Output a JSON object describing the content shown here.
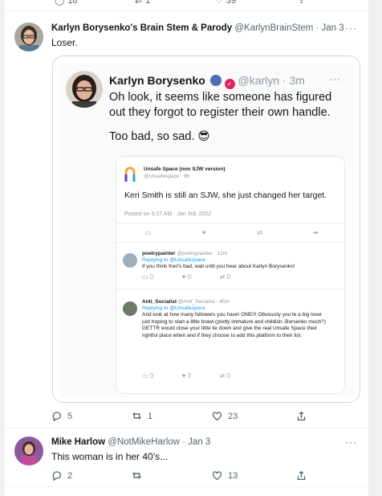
{
  "prev_actions": {
    "reply_count": "18",
    "retweet_count": "1",
    "like_count": "39"
  },
  "tweet1": {
    "display_name": "Karlyn Borysenko's Brain Stem & Parody",
    "handle": "@KarlynBrainStem",
    "date": "· Jan 3",
    "text": "Loser.",
    "more_label": "···",
    "reply_count": "5",
    "retweet_count": "1",
    "like_count": "23",
    "quoted_screenshot": {
      "display_name": "Karlyn Borysenko",
      "handle": "@karlyn · 3m",
      "more_label": "···",
      "text": "Oh look, it seems like someone has figured out they forgot to register their own handle.",
      "text2": "Too bad, so sad. 😎",
      "card": {
        "name": "Unsafe Space (non SJW version)",
        "handle": "@Unsafespace · 6h",
        "text": "Keri Smith is still an SJW, she just changed her target.",
        "posted": "Posted on 9:37 AM · Jan 3rd, 2022",
        "reply1": {
          "name": "poetrypainter",
          "handle": "@poetrypainter · 12m",
          "replying": "Replying to @Unsafespace",
          "text": "If you think Keri's bad, wait until you hear about Karlyn Borysenko!",
          "counts": [
            "0",
            "0",
            "0"
          ]
        },
        "reply2": {
          "name": "Anti_Socialist",
          "handle": "@Anti_Socialist · 45m",
          "replying": "Replying to @Unsafespace",
          "text": "And look at how many followers you have! ONE!!! Obviously you're a big loser just hoping to start a little brawl (pretty immature and childish..Borsenko much?) GETTR would close your little lie down and give the real Unsafe Space their rightful place when and if they choose to add this platform to their list.",
          "counts": [
            "0",
            "0",
            "0"
          ]
        }
      }
    }
  },
  "tweet2": {
    "display_name": "Mike Harlow",
    "handle": "@NotMikeHarlow",
    "date": "· Jan 3",
    "text": "This woman is in her 40’s...",
    "more_label": "···",
    "reply_count": "2",
    "like_count": "13"
  },
  "colors": {
    "muted": "#536471",
    "verified_red": "#e0245e",
    "avatar_bg": "#b1b7c0"
  }
}
